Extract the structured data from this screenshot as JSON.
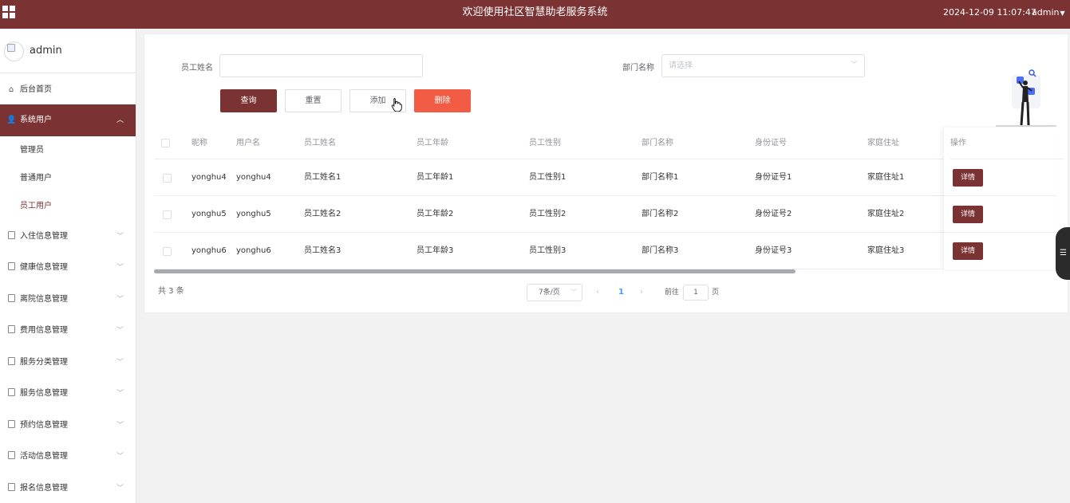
{
  "header": {
    "title": "欢迎使用社区智慧助老服务系统",
    "datetime": "2024-12-09 11:07:47",
    "user": "admin"
  },
  "sidebar": {
    "username": "admin",
    "items": [
      {
        "label": "后台首页",
        "icon": "home-icon"
      },
      {
        "label": "系统用户",
        "icon": "user-icon",
        "active": true
      },
      {
        "label": "入住信息管理",
        "icon": "document-icon"
      },
      {
        "label": "健康信息管理",
        "icon": "document-icon"
      },
      {
        "label": "离院信息管理",
        "icon": "document-icon"
      },
      {
        "label": "费用信息管理",
        "icon": "document-icon"
      },
      {
        "label": "服务分类管理",
        "icon": "document-icon"
      },
      {
        "label": "服务信息管理",
        "icon": "document-icon"
      },
      {
        "label": "预约信息管理",
        "icon": "document-icon"
      },
      {
        "label": "活动信息管理",
        "icon": "document-icon"
      },
      {
        "label": "报名信息管理",
        "icon": "document-icon"
      }
    ],
    "sub_items": [
      {
        "label": "管理员"
      },
      {
        "label": "普通用户"
      },
      {
        "label": "员工用户",
        "current": true
      }
    ]
  },
  "filters": {
    "name_label": "员工姓名",
    "name_value": "",
    "dept_label": "部门名称",
    "dept_placeholder": "请选择"
  },
  "buttons": {
    "search": "查询",
    "reset": "重置",
    "add": "添加",
    "delete": "删除"
  },
  "table": {
    "columns": [
      "昵称",
      "用户名",
      "员工姓名",
      "员工年龄",
      "员工性别",
      "部门名称",
      "身份证号",
      "家庭住址",
      "操作"
    ],
    "rows": [
      {
        "nickname": "yonghu4",
        "username": "yonghu4",
        "name": "员工姓名1",
        "age": "员工年龄1",
        "gender": "员工性别1",
        "dept": "部门名称1",
        "idcard": "身份证号1",
        "address": "家庭住址1",
        "action": "详情"
      },
      {
        "nickname": "yonghu5",
        "username": "yonghu5",
        "name": "员工姓名2",
        "age": "员工年龄2",
        "gender": "员工性别2",
        "dept": "部门名称2",
        "idcard": "身份证号2",
        "address": "家庭住址2",
        "action": "详情"
      },
      {
        "nickname": "yonghu6",
        "username": "yonghu6",
        "name": "员工姓名3",
        "age": "员工年龄3",
        "gender": "员工性别3",
        "dept": "部门名称3",
        "idcard": "身份证号3",
        "address": "家庭住址3",
        "action": "详情"
      }
    ]
  },
  "pagination": {
    "total": "共 3 条",
    "page_size": "7条/页",
    "current_page": "1",
    "goto_prefix": "前往",
    "goto_value": "1",
    "goto_suffix": "页"
  },
  "colors": {
    "brand": "#7b3233",
    "danger": "#f25c45",
    "link": "#409eff"
  }
}
